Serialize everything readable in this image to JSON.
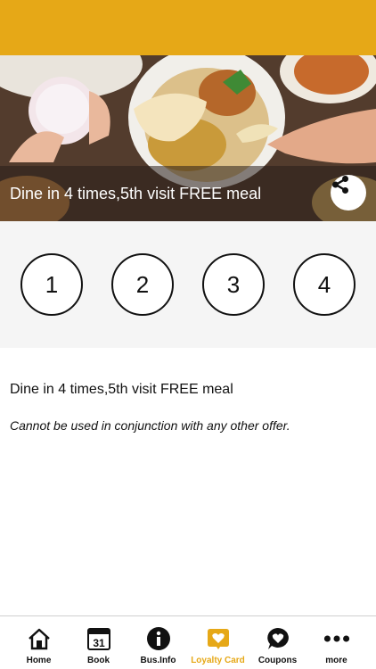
{
  "offer": {
    "title": "Dine in 4 times,5th visit FREE meal",
    "description": "Dine in 4 times,5th visit FREE meal",
    "terms": "Cannot be used in conjunction with any other offer."
  },
  "stamps": [
    "1",
    "2",
    "3",
    "4"
  ],
  "tabs": [
    {
      "label": "Home",
      "icon": "home-icon"
    },
    {
      "label": "Book",
      "icon": "calendar-icon",
      "badge": "31"
    },
    {
      "label": "Bus.Info",
      "icon": "info-icon"
    },
    {
      "label": "Loyalty Card",
      "icon": "heart-badge-icon"
    },
    {
      "label": "Coupons",
      "icon": "heart-chat-icon"
    },
    {
      "label": "more",
      "icon": "more-icon"
    }
  ],
  "active_tab": "Loyalty Card",
  "colors": {
    "accent": "#e6a817",
    "stamp_area": "#f5f5f5"
  }
}
